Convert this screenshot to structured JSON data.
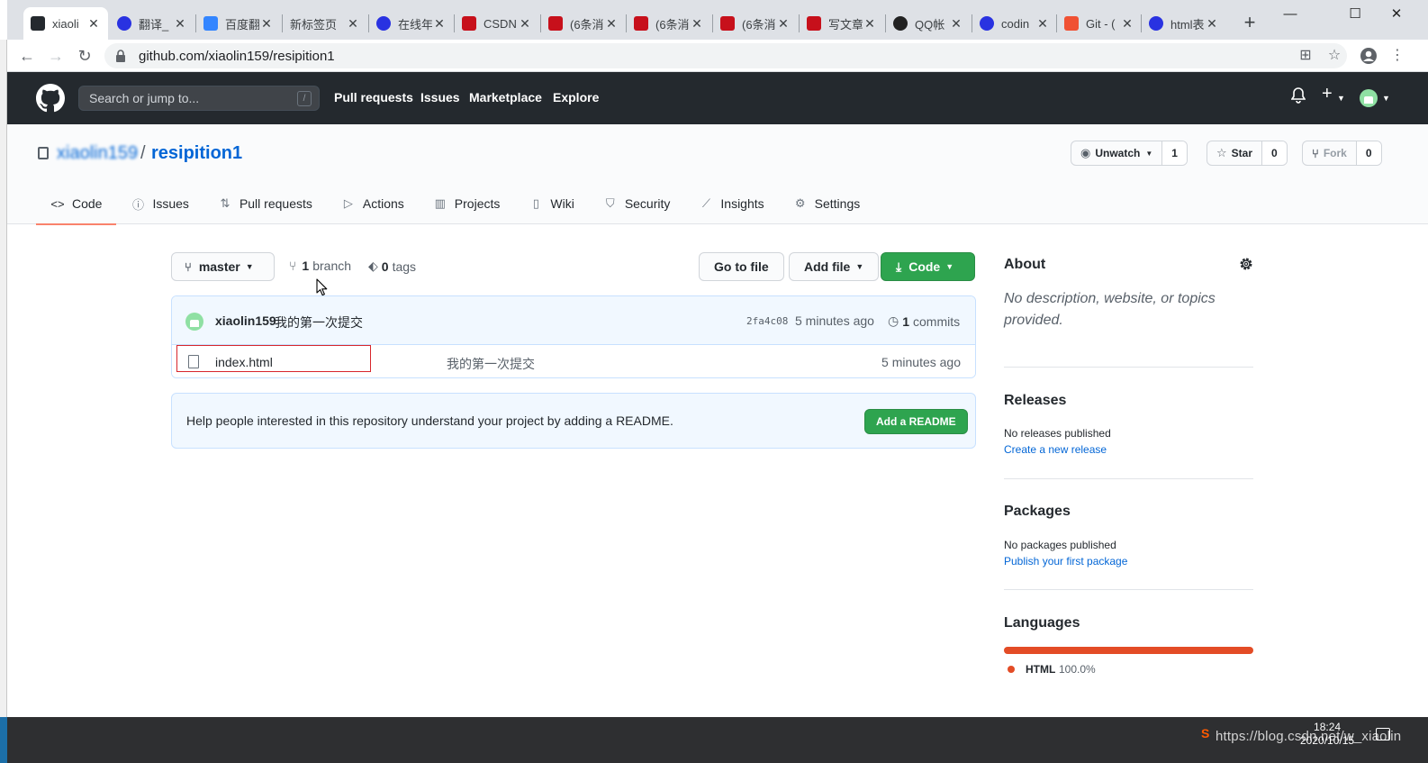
{
  "browser": {
    "tabs": [
      {
        "title": "xiaoli",
        "favicon": "github-icon",
        "color": "#24292e",
        "active": true
      },
      {
        "title": "翻译_",
        "favicon": "baidu-paw-icon",
        "color": "#2932e1"
      },
      {
        "title": "百度翻",
        "favicon": "baidu-fanyi-icon",
        "color": "#3385ff"
      },
      {
        "title": "新标签页",
        "favicon": "",
        "color": ""
      },
      {
        "title": "在线年",
        "favicon": "baidu-paw-icon",
        "color": "#2932e1"
      },
      {
        "title": "CSDN",
        "favicon": "csdn-icon",
        "color": "#c7101b"
      },
      {
        "title": "(6条消",
        "favicon": "csdn-icon",
        "color": "#c7101b"
      },
      {
        "title": "(6条消",
        "favicon": "csdn-icon",
        "color": "#c7101b"
      },
      {
        "title": "(6条消",
        "favicon": "csdn-icon",
        "color": "#c7101b"
      },
      {
        "title": "写文章",
        "favicon": "csdn-icon",
        "color": "#c7101b"
      },
      {
        "title": "QQ帐",
        "favicon": "qq-penguin-icon",
        "color": "#222222"
      },
      {
        "title": "codin",
        "favicon": "baidu-paw-icon",
        "color": "#2932e1"
      },
      {
        "title": "Git - (",
        "favicon": "git-icon",
        "color": "#f05133"
      },
      {
        "title": "html表",
        "favicon": "baidu-paw-icon",
        "color": "#2932e1"
      }
    ],
    "new_tab": "+",
    "url": "github.com/xiaolin159/resipition1"
  },
  "gh": {
    "search_placeholder": "Search or jump to...",
    "search_key": "/",
    "nav": [
      "Pull requests",
      "Issues",
      "Marketplace",
      "Explore"
    ]
  },
  "repo": {
    "owner": "xiaolin159",
    "slash": "/",
    "name": "resipition1",
    "unwatch_label": "Unwatch",
    "watch_count": "1",
    "star_label": "Star",
    "star_count": "0",
    "fork_label": "Fork",
    "fork_count": "0",
    "tabs": [
      {
        "label": "Code",
        "icon": "code-icon",
        "glyph": "<>"
      },
      {
        "label": "Issues",
        "icon": "issue-opened-icon",
        "glyph": "ⓘ"
      },
      {
        "label": "Pull requests",
        "icon": "git-pull-request-icon",
        "glyph": "⇅"
      },
      {
        "label": "Actions",
        "icon": "play-icon",
        "glyph": "▷"
      },
      {
        "label": "Projects",
        "icon": "project-icon",
        "glyph": "▥"
      },
      {
        "label": "Wiki",
        "icon": "book-icon",
        "glyph": "▯"
      },
      {
        "label": "Security",
        "icon": "shield-icon",
        "glyph": "⛉"
      },
      {
        "label": "Insights",
        "icon": "graph-icon",
        "glyph": "⟋"
      },
      {
        "label": "Settings",
        "icon": "gear-icon",
        "glyph": "⚙"
      }
    ]
  },
  "toolbar": {
    "branch_button": "master",
    "branch_count": "1",
    "branch_word": "branch",
    "tag_count": "0",
    "tag_word": "tags",
    "go_to_file": "Go to file",
    "add_file": "Add file",
    "code": "Code"
  },
  "commit": {
    "author": "xiaolin159",
    "message": "我的第一次提交",
    "sha": "2fa4c08",
    "time": "5 minutes ago",
    "count": "1",
    "count_word": "commits"
  },
  "files": [
    {
      "name": "index.html",
      "message": "我的第一次提交",
      "time": "5 minutes ago"
    }
  ],
  "readme": {
    "text": "Help people interested in this repository understand your project by adding a README.",
    "button": "Add a README"
  },
  "sidebar": {
    "about_title": "About",
    "about_desc": "No description, website, or topics provided.",
    "releases_title": "Releases",
    "releases_text": "No releases published",
    "releases_link": "Create a new release",
    "packages_title": "Packages",
    "packages_text": "No packages published",
    "packages_link": "Publish your first package",
    "languages_title": "Languages",
    "language_name": "HTML",
    "language_pct": "100.0%",
    "language_fraction": 1.0,
    "language_color": "#e34c26"
  },
  "taskbar": {
    "time": "18:24",
    "date": "2020/10/15",
    "watermark": "https://blog.csdn.net/w_xiaolin"
  }
}
